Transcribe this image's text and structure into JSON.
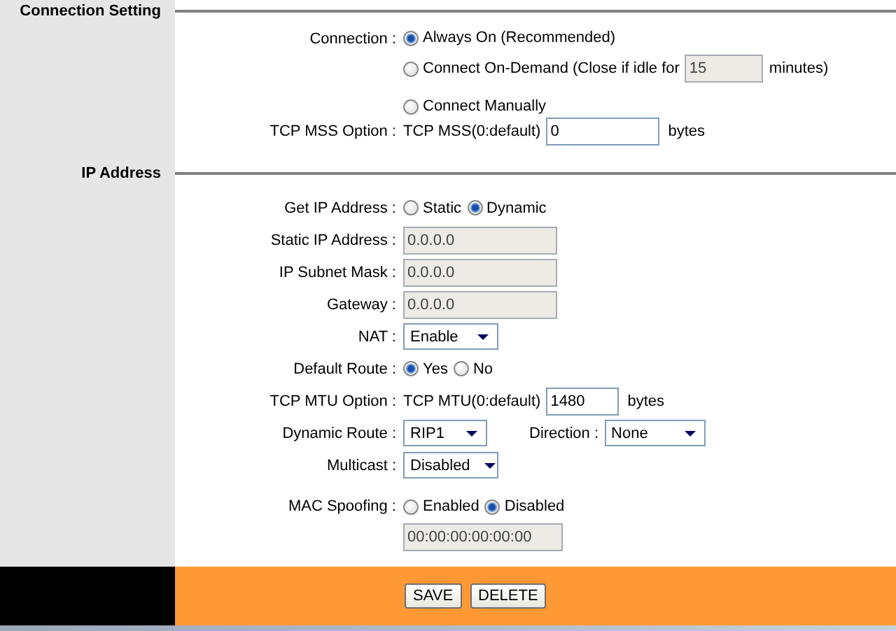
{
  "sections": [
    {
      "title": "Connection Setting",
      "rows": [
        {
          "label": "Connection :",
          "kind": "radio_list",
          "options": [
            {
              "label": "Always On (Recommended)",
              "selected": true
            },
            {
              "label": "Connect On-Demand (Close if idle for",
              "selected": false,
              "field": {
                "value": "15",
                "disabled": true
              },
              "suffix": "minutes)"
            },
            {
              "label": "Connect Manually",
              "selected": false
            }
          ]
        },
        {
          "label": "TCP MSS Option :",
          "kind": "text",
          "prefix": "TCP MSS(0:default)",
          "value": "0",
          "disabled": false,
          "suffix": "bytes"
        }
      ]
    },
    {
      "title": "IP Address",
      "rows": [
        {
          "label": "Get IP Address :",
          "kind": "radio_inline",
          "options": [
            {
              "label": "Static",
              "selected": false
            },
            {
              "label": "Dynamic",
              "selected": true
            }
          ]
        },
        {
          "label": "Static IP Address :",
          "kind": "text",
          "value": "0.0.0.0",
          "disabled": true
        },
        {
          "label": "IP Subnet Mask :",
          "kind": "text",
          "value": "0.0.0.0",
          "disabled": true
        },
        {
          "label": "Gateway :",
          "kind": "text",
          "value": "0.0.0.0",
          "disabled": true
        },
        {
          "label": "NAT :",
          "kind": "select",
          "value": "Enable"
        },
        {
          "label": "Default Route :",
          "kind": "radio_inline",
          "options": [
            {
              "label": "Yes",
              "selected": true
            },
            {
              "label": "No",
              "selected": false
            }
          ]
        },
        {
          "label": "TCP MTU Option :",
          "kind": "text",
          "prefix": "TCP MTU(0:default)",
          "value": "1480",
          "disabled": false,
          "suffix": "bytes"
        },
        {
          "label": "Dynamic Route :",
          "kind": "select",
          "value": "RIP1",
          "extra": {
            "label": "Direction :",
            "value": "None"
          }
        },
        {
          "label": "Multicast :",
          "kind": "select",
          "value": "Disabled"
        },
        {
          "label": "MAC Spoofing :",
          "kind": "radio_inline",
          "options": [
            {
              "label": "Enabled",
              "selected": false
            },
            {
              "label": "Disabled",
              "selected": true
            }
          ],
          "field": {
            "value": "00:00:00:00:00:00",
            "disabled": true
          }
        }
      ]
    }
  ],
  "buttons": [
    "SAVE",
    "DELETE"
  ]
}
